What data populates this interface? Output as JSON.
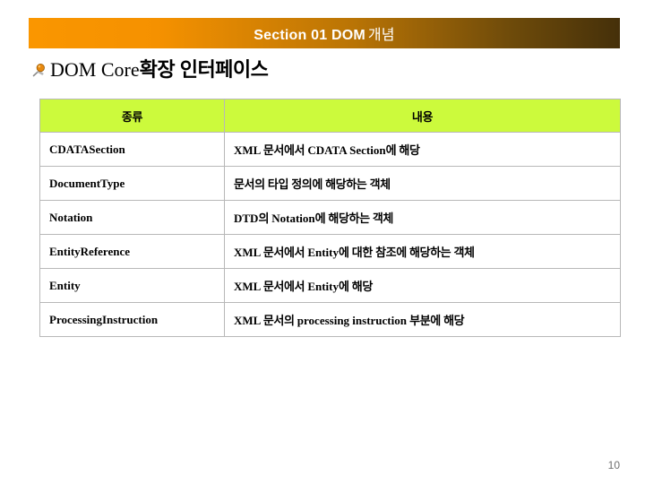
{
  "banner": {
    "title_latin": "Section 01 DOM",
    "title_kr": "개념",
    "gradient_start": "#fa9600",
    "gradient_end": "#45300a",
    "text_color": "#ffffff"
  },
  "heading": {
    "bullet_icon": "pushpin-icon",
    "latin": "DOM Core",
    "kr": "확장 인터페이스"
  },
  "table": {
    "header_bg": "#ccfa3c",
    "border_color": "#b8b8b8",
    "columns": [
      "종류",
      "내용"
    ],
    "rows": [
      {
        "kind": "CDATASection",
        "desc_part1_latin": "XML ",
        "desc_part2_kr": "문서에서 ",
        "desc_part3_latin": "CDATA Section",
        "desc_part4_kr": "에 해당"
      },
      {
        "kind": "DocumentType",
        "desc_part1_latin": "",
        "desc_part2_kr": "문서의 타입 정의에 해당하는 객체",
        "desc_part3_latin": "",
        "desc_part4_kr": ""
      },
      {
        "kind": "Notation",
        "desc_part1_latin": "DTD",
        "desc_part2_kr": "의 ",
        "desc_part3_latin": "Notation",
        "desc_part4_kr": "에 해당하는 객체"
      },
      {
        "kind": "EntityReference",
        "desc_part1_latin": "XML ",
        "desc_part2_kr": "문서에서 ",
        "desc_part3_latin": "Entity",
        "desc_part4_kr": "에 대한 참조에 해당하는 객체"
      },
      {
        "kind": "Entity",
        "desc_part1_latin": "XML ",
        "desc_part2_kr": "문서에서 ",
        "desc_part3_latin": "Entity",
        "desc_part4_kr": "에 해당"
      },
      {
        "kind": "ProcessingInstruction",
        "desc_part1_latin": "XML ",
        "desc_part2_kr": "문서의 ",
        "desc_part3_latin": "processing instruction",
        "desc_part4_kr": " 부분에 해당"
      }
    ]
  },
  "footer": {
    "page_number": "10"
  }
}
